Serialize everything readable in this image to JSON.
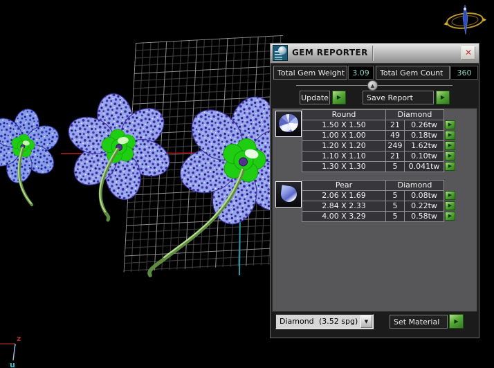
{
  "window": {
    "title": "GEM REPORTER",
    "close": "✕"
  },
  "summary": {
    "weight_label": "Total Gem Weight",
    "weight_value": "3.09",
    "count_label": "Total Gem Count",
    "count_value": "360"
  },
  "actions": {
    "update": "Update",
    "save_report": "Save Report",
    "set_material": "Set Material",
    "arrow_glyph": "▶",
    "collapse_glyph": "▲",
    "dropdown_glyph": "▼"
  },
  "material": {
    "name": "Diamond",
    "density": "(3.52 spg)"
  },
  "gem_tables": {
    "round": {
      "shape": "Round",
      "material": "Diamond",
      "rows": [
        {
          "size": "1.50 X 1.50",
          "count": "21",
          "weight": "0.26tw"
        },
        {
          "size": "1.00 X 1.00",
          "count": "49",
          "weight": "0.18tw"
        },
        {
          "size": "1.20 X 1.20",
          "count": "249",
          "weight": "1.62tw"
        },
        {
          "size": "1.10 X 1.10",
          "count": "21",
          "weight": "0.10tw"
        },
        {
          "size": "1.30 X 1.30",
          "count": "5",
          "weight": "0.041tw"
        }
      ]
    },
    "pear": {
      "shape": "Pear",
      "material": "Diamond",
      "rows": [
        {
          "size": "2.06 X 1.69",
          "count": "5",
          "weight": "0.08tw"
        },
        {
          "size": "2.84 X 2.33",
          "count": "5",
          "weight": "0.22tw"
        },
        {
          "size": "4.00 X 3.29",
          "count": "5",
          "weight": "0.58tw"
        }
      ]
    }
  },
  "viewport": {
    "axis_z": "z",
    "axis_u": "u"
  },
  "colors": {
    "accent_green": "#4a9c30",
    "value_teal": "#8fd8c8",
    "axis_red": "#b82020",
    "construction_teal": "#2e9aa8",
    "petal_blue": "#96a5ec",
    "center_green": "#1fce12"
  }
}
